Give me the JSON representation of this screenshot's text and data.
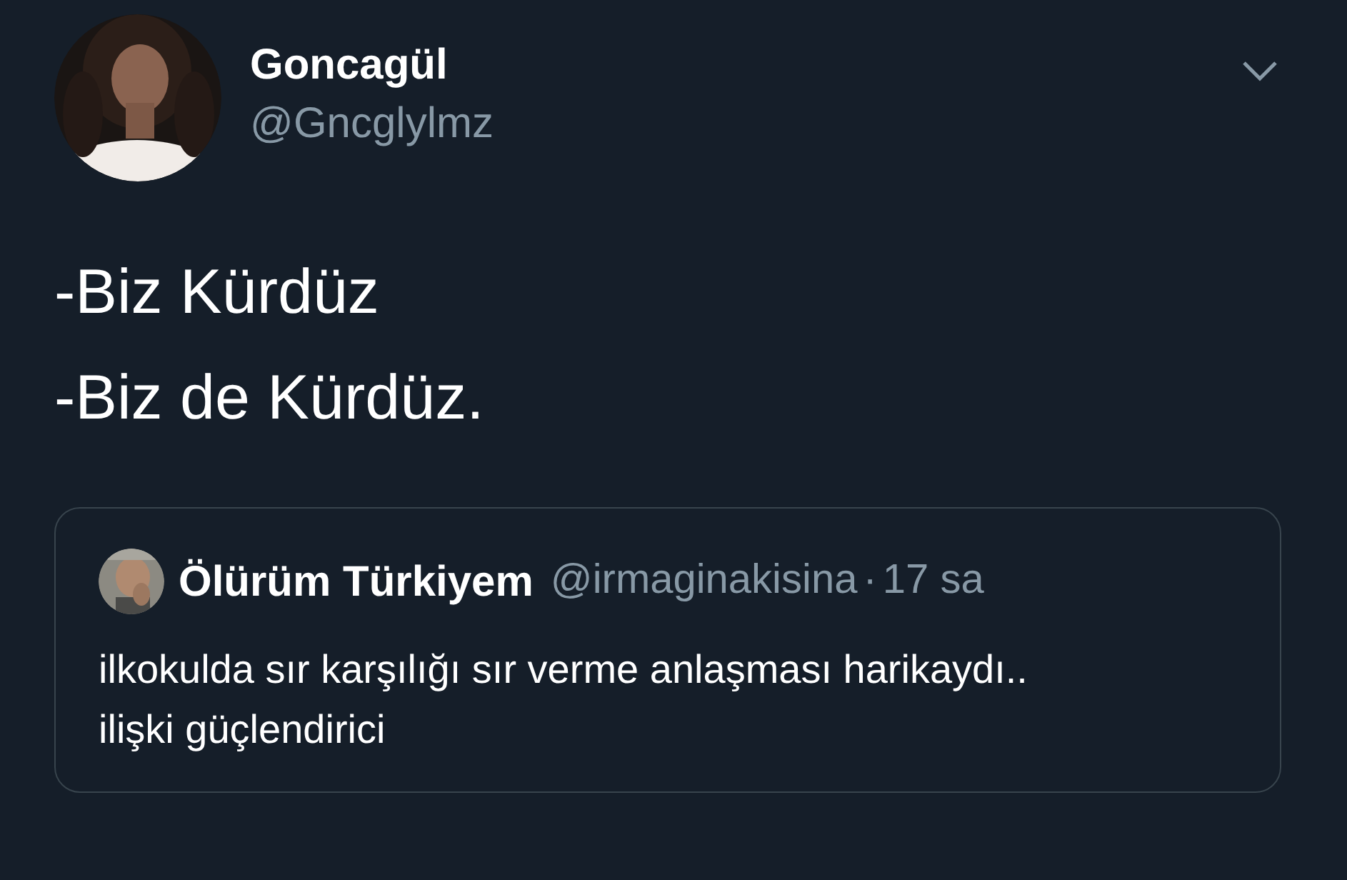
{
  "author": {
    "name": "Goncagül",
    "handle": "@Gncglylmz"
  },
  "tweet_lines": [
    "-Biz Kürdüz",
    "-Biz de Kürdüz."
  ],
  "quoted": {
    "name": "Ölürüm Türkiyem",
    "handle": "@irmaginakisina",
    "separator": "·",
    "time": "17 sa",
    "text": "ilkokulda sır karşılığı sır verme anlaşması harikaydı.. ilişki güçlendirici"
  }
}
